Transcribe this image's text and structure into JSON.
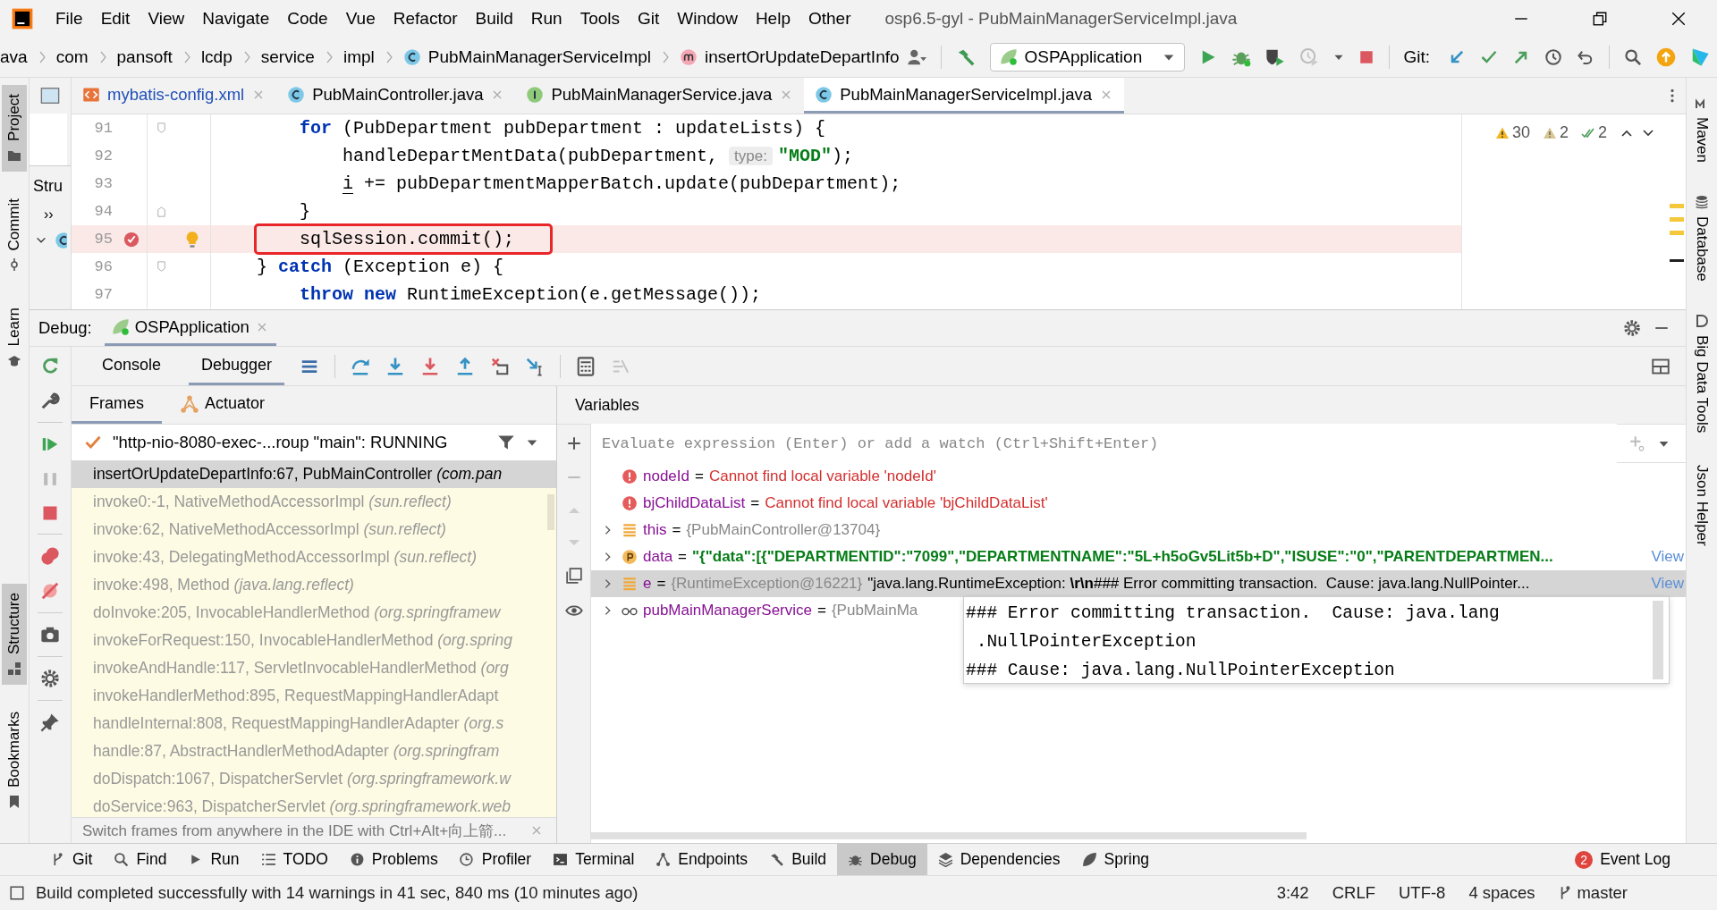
{
  "menu": [
    "File",
    "Edit",
    "View",
    "Navigate",
    "Code",
    "Vue",
    "Refactor",
    "Build",
    "Run",
    "Tools",
    "Git",
    "Window",
    "Help",
    "Other"
  ],
  "window_title": "osp6.5-gyl - PubMainManagerServiceImpl.java",
  "breadcrumbs": [
    {
      "label": "ava",
      "kind": "package"
    },
    {
      "label": "com",
      "kind": "package"
    },
    {
      "label": "pansoft",
      "kind": "package"
    },
    {
      "label": "lcdp",
      "kind": "package"
    },
    {
      "label": "service",
      "kind": "package"
    },
    {
      "label": "impl",
      "kind": "package"
    },
    {
      "label": "PubMainManagerServiceImpl",
      "kind": "class"
    },
    {
      "label": "insertOrUpdateDepartInfo",
      "kind": "method"
    }
  ],
  "toolbar": {
    "run_configuration": "OSPApplication",
    "vcs_label": "Git:"
  },
  "left_tool_tabs_top": [
    {
      "label": "Project",
      "kind": "project",
      "selected": true
    },
    {
      "label": "Commit",
      "kind": "commit",
      "selected": false
    },
    {
      "label": "Learn",
      "kind": "learn",
      "selected": false
    }
  ],
  "left_tool_tabs_bottom": [
    {
      "label": "Structure",
      "kind": "structure",
      "selected": true
    },
    {
      "label": "Bookmarks",
      "kind": "bookmarks",
      "selected": false
    }
  ],
  "right_tool_tabs": [
    {
      "label": "Maven",
      "kind": "maven"
    },
    {
      "label": "Database",
      "kind": "database"
    },
    {
      "label": "Big Data Tools",
      "kind": "bigdata"
    },
    {
      "label": "Json Helper",
      "kind": "plain"
    }
  ],
  "structure_panel": {
    "title": "Stru",
    "toggle": "››"
  },
  "editor_tabs": [
    {
      "label": "mybatis-config.xml",
      "kind": "xml",
      "selected": false
    },
    {
      "label": "PubMainController.java",
      "kind": "class",
      "selected": false
    },
    {
      "label": "PubMainManagerService.java",
      "kind": "interface",
      "selected": false
    },
    {
      "label": "PubMainManagerServiceImpl.java",
      "kind": "class",
      "selected": true
    }
  ],
  "inspections": [
    {
      "kind": "warning",
      "count": "30"
    },
    {
      "kind": "weak_warning",
      "count": "2"
    },
    {
      "kind": "typo",
      "count": "2"
    }
  ],
  "code_lines": [
    {
      "number": "91",
      "fold_start": true,
      "fold_end": false,
      "breakpoint": false,
      "current": false,
      "bulb": false,
      "segments": [
        {
          "kind": "keyword",
          "text": "        for"
        },
        {
          "kind": "plain",
          "text": " (PubDepartment pubDepartment : updateLists) {"
        }
      ]
    },
    {
      "number": "92",
      "fold_start": false,
      "fold_end": false,
      "breakpoint": false,
      "current": false,
      "bulb": false,
      "segments": [
        {
          "kind": "plain",
          "text": "            handleDepartMentData(pubDepartment, "
        },
        {
          "kind": "hint",
          "text": "type:"
        },
        {
          "kind": "string",
          "text": "\"MOD\""
        },
        {
          "kind": "plain",
          "text": ");"
        }
      ]
    },
    {
      "number": "93",
      "fold_start": false,
      "fold_end": false,
      "breakpoint": false,
      "current": false,
      "bulb": false,
      "segments": [
        {
          "kind": "underline",
          "text": "            i"
        },
        {
          "kind": "plain",
          "text": " += pubDepartmentMapperBatch.update(pubDepartment);"
        }
      ]
    },
    {
      "number": "94",
      "fold_start": false,
      "fold_end": true,
      "breakpoint": false,
      "current": false,
      "bulb": false,
      "segments": [
        {
          "kind": "plain",
          "text": "        }"
        }
      ]
    },
    {
      "number": "95",
      "fold_start": false,
      "fold_end": false,
      "breakpoint": true,
      "current": true,
      "bulb": true,
      "segments": [
        {
          "kind": "boxed",
          "text": "    sqlSession.commit();"
        }
      ]
    },
    {
      "number": "96",
      "fold_start": true,
      "fold_end": false,
      "breakpoint": false,
      "current": false,
      "bulb": false,
      "segments": [
        {
          "kind": "plain",
          "text": "    } "
        },
        {
          "kind": "keyword",
          "text": "catch"
        },
        {
          "kind": "plain",
          "text": " (Exception e) {"
        }
      ]
    },
    {
      "number": "97",
      "fold_start": false,
      "fold_end": false,
      "breakpoint": false,
      "current": false,
      "bulb": false,
      "segments": [
        {
          "kind": "keyword",
          "text": "        throw new"
        },
        {
          "kind": "plain",
          "text": " RuntimeException(e.getMessage());"
        }
      ]
    }
  ],
  "debug": {
    "title": "Debug:",
    "session": "OSPApplication",
    "tabs": [
      {
        "label": "Console",
        "selected": false
      },
      {
        "label": "Debugger",
        "selected": true
      }
    ],
    "frame_tabs": [
      {
        "label": "Frames",
        "kind": "frames",
        "selected": true
      },
      {
        "label": "Actuator",
        "kind": "actuator",
        "selected": false
      }
    ],
    "thread": "\"http-nio-8080-exec-...roup \"main\": RUNNING",
    "frames": [
      {
        "text": "insertOrUpdateDepartInfo:67, PubMainController *(com.pan*",
        "kind": "project",
        "selected": true
      },
      {
        "text": "invoke0:-1, NativeMethodAccessorImpl *(sun.reflect)*",
        "kind": "library",
        "selected": false
      },
      {
        "text": "invoke:62, NativeMethodAccessorImpl *(sun.reflect)*",
        "kind": "library",
        "selected": false
      },
      {
        "text": "invoke:43, DelegatingMethodAccessorImpl *(sun.reflect)*",
        "kind": "library",
        "selected": false
      },
      {
        "text": "invoke:498, Method *(java.lang.reflect)*",
        "kind": "library",
        "selected": false
      },
      {
        "text": "doInvoke:205, InvocableHandlerMethod *(org.springframew*",
        "kind": "library",
        "selected": false
      },
      {
        "text": "invokeForRequest:150, InvocableHandlerMethod *(org.spring*",
        "kind": "library",
        "selected": false
      },
      {
        "text": "invokeAndHandle:117, ServletInvocableHandlerMethod *(org*",
        "kind": "library",
        "selected": false
      },
      {
        "text": "invokeHandlerMethod:895, RequestMappingHandlerAdapt",
        "kind": "library",
        "selected": false
      },
      {
        "text": "handleInternal:808, RequestMappingHandlerAdapter *(org.s*",
        "kind": "library",
        "selected": false
      },
      {
        "text": "handle:87, AbstractHandlerMethodAdapter *(org.springfram*",
        "kind": "library",
        "selected": false
      },
      {
        "text": "doDispatch:1067, DispatcherServlet *(org.springframework.w*",
        "kind": "library",
        "selected": false
      },
      {
        "text": "doService:963, DispatcherServlet *(org.springframework.web*",
        "kind": "library",
        "selected": false
      }
    ],
    "hint": "Switch frames from anywhere in the IDE with Ctrl+Alt+向上箭..."
  },
  "variables": {
    "title": "Variables",
    "placeholder": "Evaluate expression (Enter) or add a watch (Ctrl+Shift+Enter)",
    "items": [
      {
        "kind": "error",
        "name": "nodeId",
        "operator": "=",
        "value": "Cannot find local variable 'nodeId'",
        "expandable": false,
        "selected": false
      },
      {
        "kind": "error",
        "name": "bjChildDataList",
        "operator": "=",
        "value": "Cannot find local variable 'bjChildDataList'",
        "expandable": false,
        "selected": false
      },
      {
        "kind": "field",
        "name": "this",
        "operator": "=",
        "type": "{PubMainController@13704}",
        "expandable": true,
        "selected": false
      },
      {
        "kind": "parameter",
        "name": "data",
        "operator": "=",
        "value": "\"{\"data\":[{\"DEPARTMENTID\":\"7099\",\"DEPARTMENTNAME\":\"5L+h5oGv5Lit5b+D\",\"ISUSE\":\"0\",\"PARENTDEPARTMEN...",
        "link": "View",
        "expandable": true,
        "selected": false
      },
      {
        "kind": "field",
        "name": "e",
        "operator": "=",
        "type": "{RuntimeException@16221}",
        "value": "\"java.lang.RuntimeException: **\\r\\n**### Error committing transaction.  Cause: java.lang.NullPointer...",
        "link": "View",
        "expandable": true,
        "selected": true
      },
      {
        "kind": "watch",
        "name": "pubMainManagerService",
        "operator": "=",
        "type": "{PubMainMa",
        "expandable": true,
        "selected": false
      }
    ]
  },
  "value_tooltip": {
    "lines": [
      "### Error committing transaction.  Cause: java.lang",
      " .NullPointerException",
      "### Cause: java.lang.NullPointerException"
    ]
  },
  "bottom_tools": [
    {
      "label": "Git",
      "kind": "git",
      "selected": false
    },
    {
      "label": "Find",
      "kind": "find",
      "selected": false
    },
    {
      "label": "Run",
      "kind": "run",
      "selected": false
    },
    {
      "label": "TODO",
      "kind": "todo",
      "selected": false
    },
    {
      "label": "Problems",
      "kind": "problems",
      "selected": false
    },
    {
      "label": "Profiler",
      "kind": "profiler",
      "selected": false
    },
    {
      "label": "Terminal",
      "kind": "terminal",
      "selected": false
    },
    {
      "label": "Endpoints",
      "kind": "endpoints",
      "selected": false
    },
    {
      "label": "Build",
      "kind": "build",
      "selected": false
    },
    {
      "label": "Debug",
      "kind": "debug",
      "selected": true
    },
    {
      "label": "Dependencies",
      "kind": "dependencies",
      "selected": false
    },
    {
      "label": "Spring",
      "kind": "spring",
      "selected": false
    }
  ],
  "event_log": {
    "label": "Event Log",
    "count": "2"
  },
  "status_bar": {
    "message": "Build completed successfully with 14 warnings in 41 sec, 840 ms (10 minutes ago)",
    "items": [
      "3:42",
      "CRLF",
      "UTF-8",
      "4 spaces"
    ],
    "branch": "master"
  }
}
